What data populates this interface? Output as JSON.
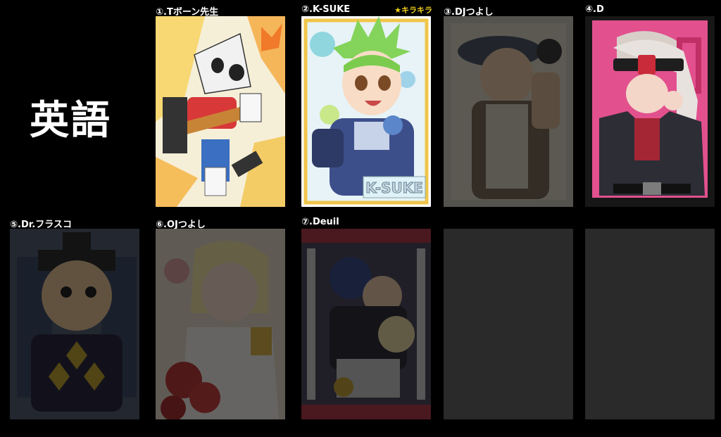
{
  "page": {
    "subject": "英語"
  },
  "cards": [
    {
      "id": "card-1",
      "label": "①.Tボーン先生",
      "badge": "",
      "state": "unlocked",
      "art": "tbone"
    },
    {
      "id": "card-2",
      "label": "②.K-SUKE",
      "badge": "★キラキラ",
      "state": "unlocked",
      "art": "ksuke",
      "art_text": "K-SUKE"
    },
    {
      "id": "card-3",
      "label": "③.DJつよし",
      "state": "locked",
      "art": "djtsuyoshi"
    },
    {
      "id": "card-4",
      "label": "④.D",
      "state": "unlocked",
      "art": "d"
    },
    {
      "id": "card-5",
      "label": "⑤.Dr.フラスコ",
      "state": "locked",
      "art": "flasko"
    },
    {
      "id": "card-6",
      "label": "⑥.OJつよし",
      "state": "locked",
      "art": "ojtsuyoshi"
    },
    {
      "id": "card-7",
      "label": "⑦.Deuil",
      "state": "locked",
      "art": "deuil"
    },
    {
      "id": "card-8",
      "label": "",
      "state": "empty"
    },
    {
      "id": "card-9",
      "label": "",
      "state": "empty"
    }
  ],
  "colors": {
    "badge": "#f2d31c",
    "empty_slot": "#2a2a2a",
    "background": "#000000"
  }
}
